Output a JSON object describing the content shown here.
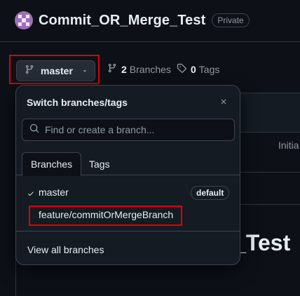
{
  "repo": {
    "name": "Commit_OR_Merge_Test",
    "visibility": "Private"
  },
  "toolbar": {
    "branch_label": "master",
    "branches_count": "2",
    "branches_label": "Branches",
    "tags_count": "0",
    "tags_label": "Tags"
  },
  "background": {
    "commit_snippet": "Initia",
    "readme_title_snippet": "_Test"
  },
  "dropdown": {
    "title": "Switch branches/tags",
    "search_placeholder": "Find or create a branch...",
    "tabs": [
      {
        "label": "Branches",
        "active": true
      },
      {
        "label": "Tags",
        "active": false
      }
    ],
    "branches": [
      {
        "name": "master",
        "checked": true,
        "badge": "default"
      },
      {
        "name": "feature/commitOrMergeBranch",
        "checked": false,
        "badge": ""
      }
    ],
    "footer_link": "View all branches"
  },
  "colors": {
    "background": "#0d1117",
    "overlay": "#151b23",
    "border": "#3d444d",
    "highlight": "#e00000",
    "muted_text": "#9198a1"
  }
}
